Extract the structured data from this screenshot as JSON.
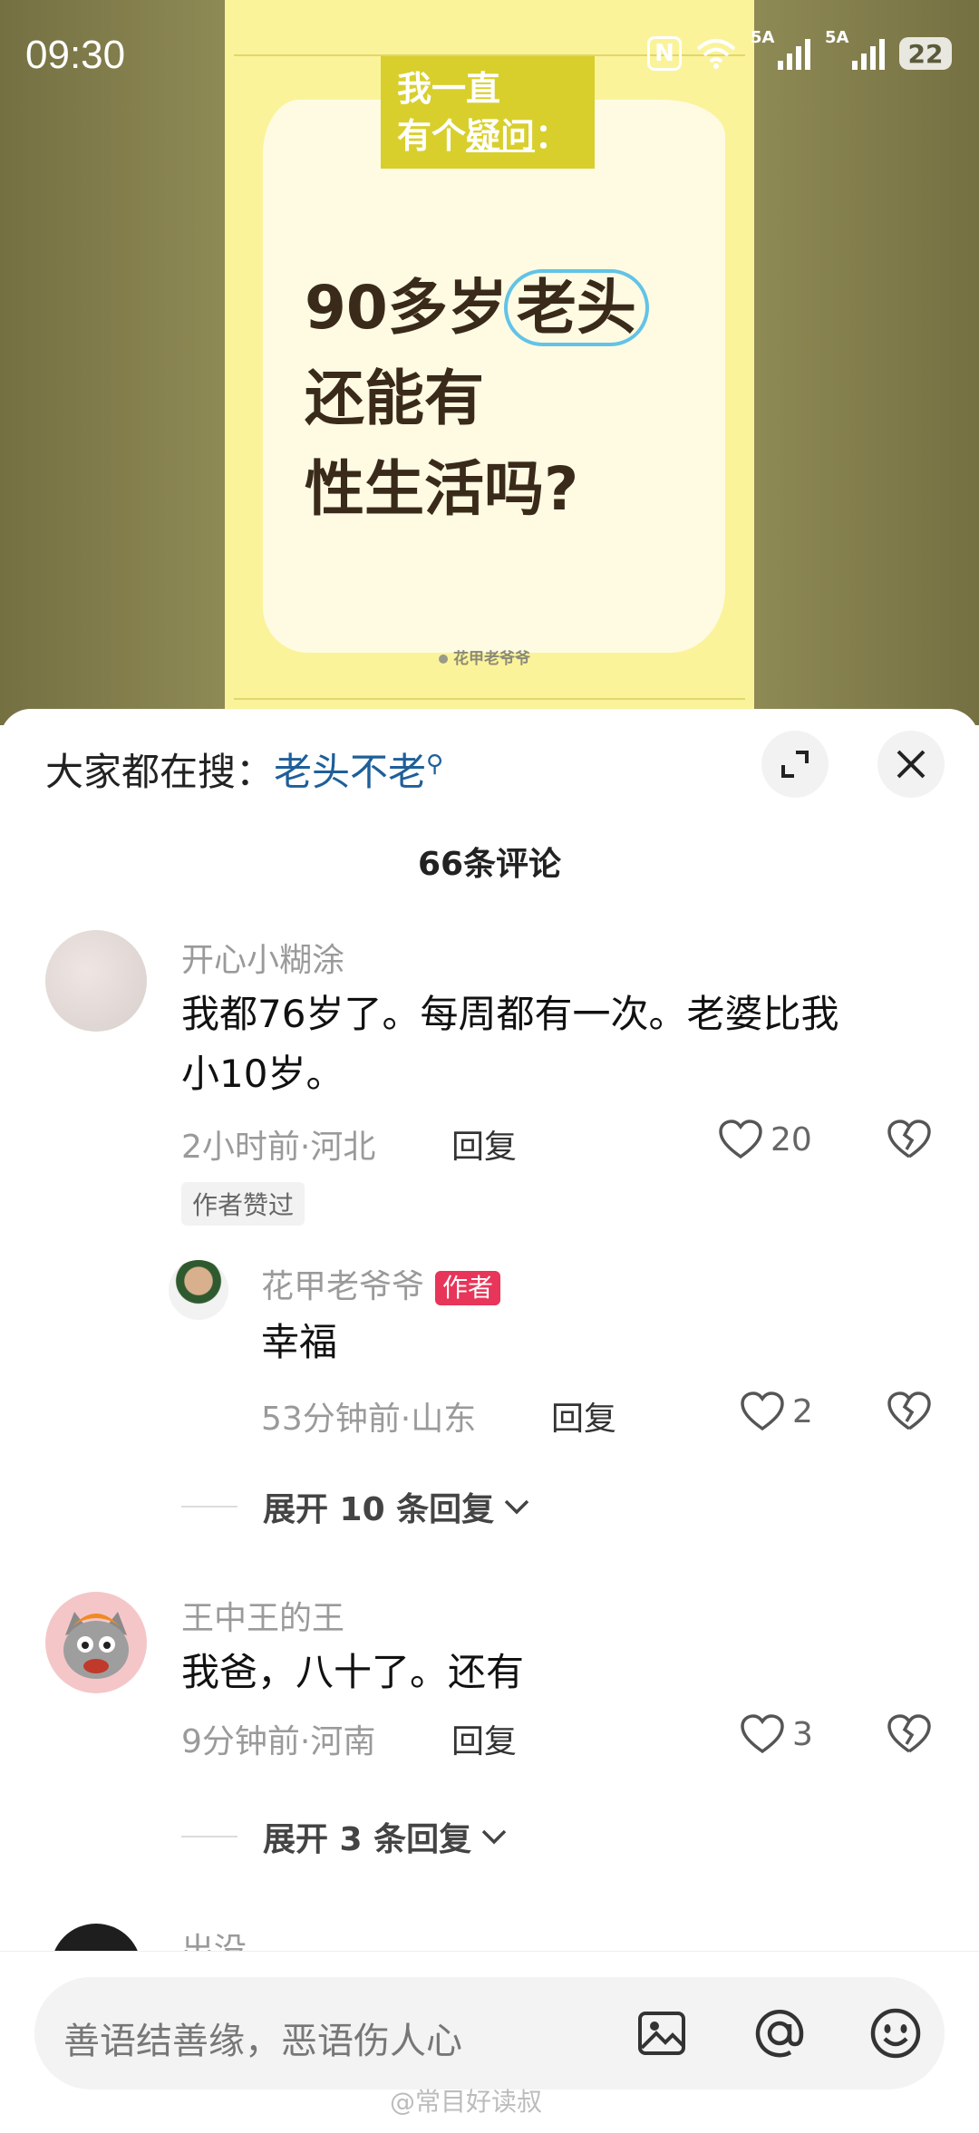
{
  "status_bar": {
    "time": "09:30",
    "sim1": "5A",
    "sim2": "5A",
    "battery": "22"
  },
  "cover": {
    "tag_line1": "我一直",
    "tag_line2a": "有个",
    "tag_line2b": "疑问",
    "tag_colon": "：",
    "headline_pre": "90多岁",
    "headline_circled": "老头",
    "headline_line2": "还能有",
    "headline_line3": "性生活吗?",
    "watermark": "花甲老爷爷"
  },
  "search": {
    "prefix": "大家都在搜：",
    "keyword": "老头不老"
  },
  "comments_count": "66条评论",
  "comments": [
    {
      "username": "开心小糊涂",
      "text_line1": "我都76岁了。每周都有一次。老婆比我",
      "text_line2": "小10岁。",
      "meta": "2小时前·河北",
      "reply": "回复",
      "likes": "20",
      "liked_tag": "作者赞过"
    },
    {
      "username": "花甲老爷爷",
      "badge": "作者",
      "text": "幸福",
      "meta": "53分钟前·山东",
      "reply": "回复",
      "likes": "2"
    },
    {
      "expand": "展开 10 条回复"
    },
    {
      "username": "王中王的王",
      "text": "我爸，八十了。还有",
      "meta": "9分钟前·河南",
      "reply": "回复",
      "likes": "3"
    },
    {
      "expand": "展开 3 条回复"
    },
    {
      "username": "出没"
    }
  ],
  "input": {
    "placeholder": "善语结善缘，恶语伤人心"
  },
  "watermark_bottom": "@常目好读叔",
  "colors": {
    "accent_blue": "#1e5f9a",
    "author_badge": "#e8355a",
    "cover_bg": "#fbf39a"
  },
  "icons": [
    "nfc-icon",
    "wifi-icon",
    "signal-icon",
    "battery-icon",
    "expand-icon",
    "close-icon",
    "heart-icon",
    "broken-heart-icon",
    "chevron-down-icon",
    "image-icon",
    "at-icon",
    "emoji-icon"
  ]
}
